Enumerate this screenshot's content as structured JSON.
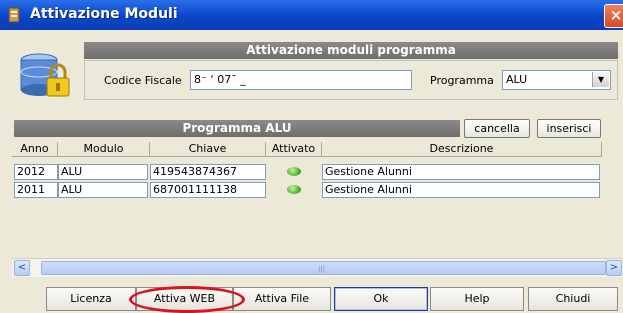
{
  "window": {
    "title": "Attivazione Moduli",
    "close_glyph": "×",
    "icon": "application-icon"
  },
  "header": {
    "title": "Attivazione moduli programma",
    "codice_fiscale_label": "Codice Fiscale",
    "codice_fiscale_value": "8⁻  ‘  07ˉ      _",
    "programma_label": "Programma",
    "programma_value": "ALU",
    "dropdown_glyph": "▼"
  },
  "section": {
    "title": "Programma ALU",
    "cancella_label": "cancella",
    "inserisci_label": "inserisci"
  },
  "table": {
    "columns": [
      "Anno",
      "Modulo",
      "Chiave",
      "Attivato",
      "Descrizione"
    ],
    "rows": [
      {
        "anno": "2012",
        "modulo": "ALU",
        "chiave": "419543874367",
        "attivato": true,
        "descrizione": "Gestione Alunni"
      },
      {
        "anno": "2011",
        "modulo": "ALU",
        "chiave": "687001111138",
        "attivato": true,
        "descrizione": "Gestione Alunni"
      }
    ]
  },
  "scrollbar": {
    "left_glyph": "<",
    "right_glyph": ">",
    "grip": "|||"
  },
  "buttons": {
    "licenza": "Licenza",
    "attiva_web": "Attiva WEB",
    "attiva_file": "Attiva File",
    "ok": "Ok",
    "help": "Help",
    "chiudi": "Chiudi"
  },
  "colors": {
    "title_bar": "#0a46c8",
    "header_gray": "#7a7a7a",
    "highlight_circle": "#d8141e",
    "led_green": "#4fb82c"
  }
}
